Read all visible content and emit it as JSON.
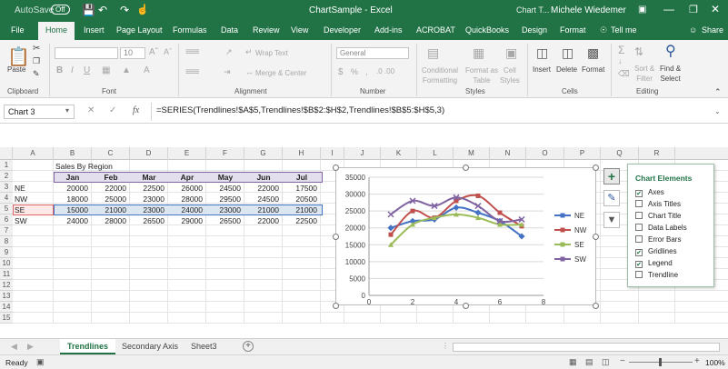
{
  "titlebar": {
    "autosave": "AutoSave",
    "autosave_state": "Off",
    "title": "ChartSample  -  Excel",
    "context": "Chart T...",
    "user": "Michele Wiedemer"
  },
  "tabs": [
    "File",
    "Home",
    "Insert",
    "Page Layout",
    "Formulas",
    "Data",
    "Review",
    "View",
    "Developer",
    "Add-ins",
    "ACROBAT",
    "QuickBooks",
    "Design",
    "Format"
  ],
  "tell_me": "Tell me",
  "share": "Share",
  "ribbon": {
    "paste": "Paste",
    "clipboard": "Clipboard",
    "font_label": "Font",
    "font_size": "10",
    "wrap_text": "Wrap Text",
    "merge_center": "Merge & Center",
    "alignment": "Alignment",
    "number_format": "General",
    "number": "Number",
    "conditional": [
      "Conditional",
      "Formatting"
    ],
    "format_table": [
      "Format as",
      "Table"
    ],
    "cell_styles": [
      "Cell",
      "Styles"
    ],
    "styles": "Styles",
    "insert": "Insert",
    "delete": "Delete",
    "format": "Format",
    "cells": "Cells",
    "sort": [
      "Sort &",
      "Filter"
    ],
    "find": [
      "Find &",
      "Select"
    ],
    "editing": "Editing"
  },
  "formula_bar": {
    "name_box": "Chart 3",
    "fx": "fx",
    "formula": "=SERIES(Trendlines!$A$5,Trendlines!$B$2:$H$2,Trendlines!$B$5:$H$5,3)"
  },
  "columns": [
    "A",
    "B",
    "C",
    "D",
    "E",
    "F",
    "G",
    "H",
    "I",
    "J",
    "K",
    "L",
    "M",
    "N",
    "O",
    "P",
    "Q",
    "R"
  ],
  "rows": [
    "1",
    "2",
    "3",
    "4",
    "5",
    "6",
    "7",
    "8",
    "9",
    "10",
    "11",
    "12",
    "13",
    "14",
    "15"
  ],
  "table": {
    "title": "Sales By Region",
    "headers": [
      "Jan",
      "Feb",
      "Mar",
      "Apr",
      "May",
      "Jun",
      "Jul"
    ],
    "rows": [
      {
        "label": "NE",
        "values": [
          "20000",
          "22000",
          "22500",
          "26000",
          "24500",
          "22000",
          "17500"
        ]
      },
      {
        "label": "NW",
        "values": [
          "18000",
          "25000",
          "23000",
          "28000",
          "29500",
          "24500",
          "20500"
        ]
      },
      {
        "label": "SE",
        "values": [
          "15000",
          "21000",
          "23000",
          "24000",
          "23000",
          "21000",
          "21000"
        ]
      },
      {
        "label": "SW",
        "values": [
          "24000",
          "28000",
          "26500",
          "29000",
          "26500",
          "22000",
          "22500"
        ]
      }
    ]
  },
  "chart_data": {
    "type": "line",
    "x": [
      1,
      2,
      3,
      4,
      5,
      6,
      7
    ],
    "series": [
      {
        "name": "NE",
        "values": [
          20000,
          22000,
          22500,
          26000,
          24500,
          22000,
          17500
        ],
        "color": "#4472c4"
      },
      {
        "name": "NW",
        "values": [
          18000,
          25000,
          23000,
          28000,
          29500,
          24500,
          20500
        ],
        "color": "#c0504d"
      },
      {
        "name": "SE",
        "values": [
          15000,
          21000,
          23000,
          24000,
          23000,
          21000,
          21000
        ],
        "color": "#9bbb59"
      },
      {
        "name": "SW",
        "values": [
          24000,
          28000,
          26500,
          29000,
          26500,
          22000,
          22500
        ],
        "color": "#8064a2"
      }
    ],
    "ylim": [
      0,
      35000
    ],
    "xlim": [
      0,
      8
    ],
    "yticks": [
      "0",
      "5000",
      "10000",
      "15000",
      "20000",
      "25000",
      "30000",
      "35000"
    ],
    "xticks": [
      "0",
      "2",
      "4",
      "6",
      "8"
    ],
    "grid": true,
    "legend": "right"
  },
  "chart_elements": {
    "title": "Chart Elements",
    "items": [
      {
        "label": "Axes",
        "checked": true
      },
      {
        "label": "Axis Titles",
        "checked": false
      },
      {
        "label": "Chart Title",
        "checked": false
      },
      {
        "label": "Data Labels",
        "checked": false
      },
      {
        "label": "Error Bars",
        "checked": false
      },
      {
        "label": "Gridlines",
        "checked": true
      },
      {
        "label": "Legend",
        "checked": true
      },
      {
        "label": "Trendline",
        "checked": false
      }
    ]
  },
  "sheets": [
    "Trendlines",
    "Secondary Axis",
    "Sheet3"
  ],
  "status": {
    "ready": "Ready",
    "zoom": "100%"
  },
  "colors": {
    "excel_green": "#217346",
    "header_fill": "#e4dfec",
    "header_border": "#8064a2"
  }
}
